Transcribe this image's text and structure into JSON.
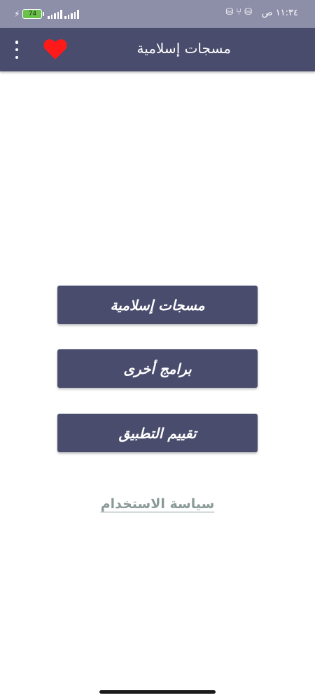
{
  "status_bar": {
    "time": "١١:٣٤ ص",
    "battery_level": "74",
    "icons": [
      "sim-icon",
      "usb-icon",
      "sim-icon"
    ]
  },
  "app_bar": {
    "title": "مسجات إسلامية",
    "favorite_icon": "heart-icon",
    "menu_icon": "more-vert-icon"
  },
  "buttons": {
    "messages": "مسجات إسلامية",
    "other_apps": "برامج أخرى",
    "rate_app": "تقييم التطبيق"
  },
  "policy_link": "سياسة الاستخدام",
  "colors": {
    "primary": "#4a4c6d",
    "status_bar": "#8d8ea8",
    "heart": "#ff1a1a",
    "link": "#8a9a98",
    "battery": "#6ac24a"
  }
}
